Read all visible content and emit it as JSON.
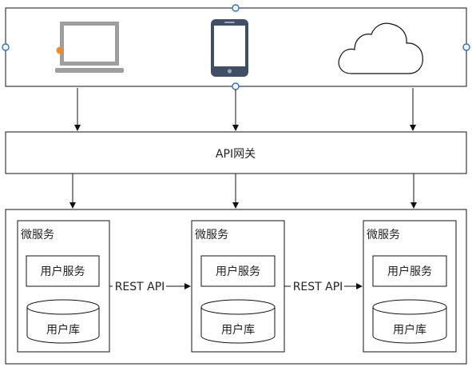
{
  "clients": [
    {
      "name": "laptop",
      "icon": "laptop-icon"
    },
    {
      "name": "phone",
      "icon": "phone-icon"
    },
    {
      "name": "cloud",
      "icon": "cloud-icon"
    }
  ],
  "gateway": {
    "label": "API网关"
  },
  "services": [
    {
      "title": "微服务",
      "service_label": "用户服务",
      "db_label": "用户库"
    },
    {
      "title": "微服务",
      "service_label": "用户服务",
      "db_label": "用户库"
    },
    {
      "title": "微服务",
      "service_label": "用户服务",
      "db_label": "用户库"
    }
  ],
  "links": [
    {
      "label": "REST API"
    },
    {
      "label": "REST API"
    }
  ],
  "colors": {
    "stroke": "#111111",
    "device_gray": "#9e9e9e",
    "phone_body": "#3f4f66",
    "handle_blue": "#1e6fd9",
    "laptop_dot": "#f08a24"
  }
}
